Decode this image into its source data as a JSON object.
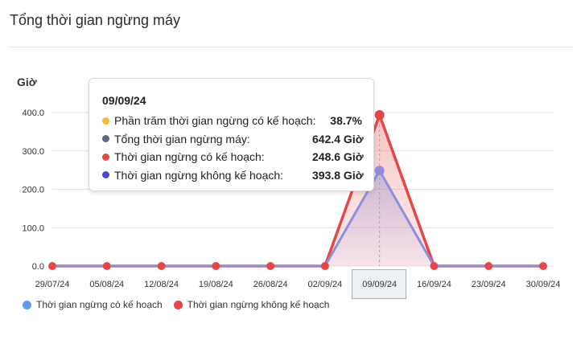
{
  "card": {
    "title": "Tổng thời gian ngừng máy"
  },
  "chart_data": {
    "type": "area",
    "ylabel": "Giờ",
    "ylim": [
      0,
      400
    ],
    "yticks": [
      "0.0",
      "100.0",
      "200.0",
      "300.0",
      "400.0"
    ],
    "categories": [
      "29/07/24",
      "05/08/24",
      "12/08/24",
      "19/08/24",
      "26/08/24",
      "02/09/24",
      "09/09/24",
      "16/09/24",
      "23/09/24",
      "30/09/24"
    ],
    "series": [
      {
        "name": "Thời gian ngừng có kế hoạch",
        "values": [
          0,
          0,
          0,
          0,
          0,
          0,
          248.6,
          0,
          0,
          0
        ],
        "color": "#8e8fd8"
      },
      {
        "name": "Thời gian ngừng không kế hoạch",
        "values": [
          0,
          0,
          0,
          0,
          0,
          0,
          393.8,
          0,
          0,
          0
        ],
        "color": "#e84545"
      }
    ],
    "grid": true,
    "legend_position": "bottom-left",
    "highlighted_category": "09/09/24"
  },
  "legend": [
    {
      "label": "Thời gian ngừng có kế hoạch",
      "color": "#5b9cf5"
    },
    {
      "label": "Thời gian ngừng không kế hoạch",
      "color": "#e84545"
    }
  ],
  "tooltip": {
    "title": "09/09/24",
    "rows": [
      {
        "label": "Phần trăm thời gian ngừng có kế hoạch:",
        "value": "38.7%",
        "color": "#f5b93b"
      },
      {
        "label": "Tổng thời gian ngừng máy:",
        "value": "642.4 Giờ",
        "color": "#5f6b7a"
      },
      {
        "label": "Thời gian ngừng có kế hoạch:",
        "value": "248.6 Giờ",
        "color": "#e84545"
      },
      {
        "label": "Thời gian ngừng không kế hoạch:",
        "value": "393.8 Giờ",
        "color": "#4b47d6"
      }
    ]
  }
}
